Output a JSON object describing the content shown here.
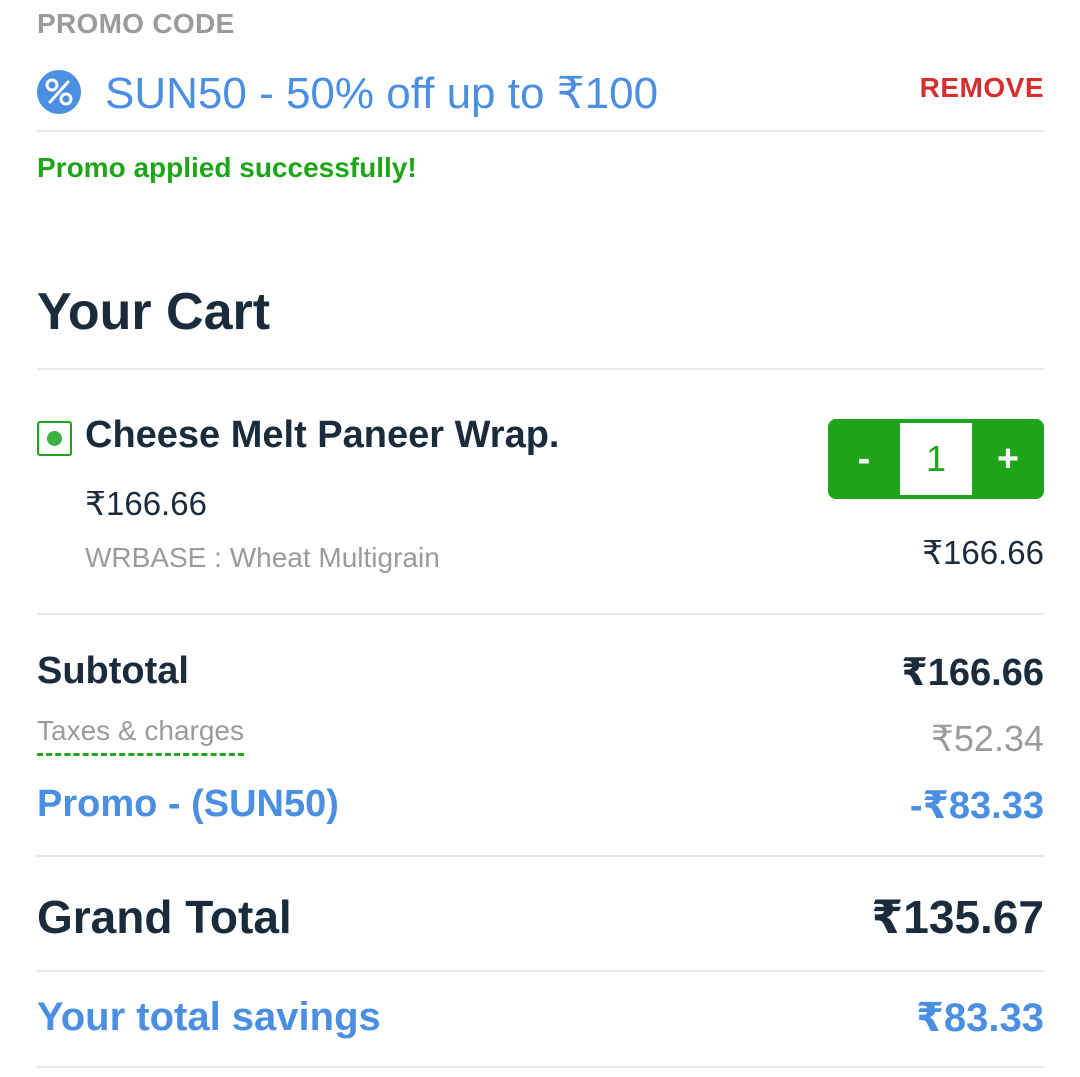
{
  "promo": {
    "section_label": "PROMO CODE",
    "applied_text": "SUN50 - 50% off up to ₹100",
    "remove_label": "REMOVE",
    "success_message": "Promo applied successfully!",
    "icon": "percent-badge-icon"
  },
  "cart": {
    "title": "Your Cart",
    "items": [
      {
        "veg_icon": "veg-indicator-icon",
        "name": "Cheese Melt Paneer Wrap.",
        "unit_price": "₹166.66",
        "customization": "WRBASE : Wheat Multigrain",
        "quantity": "1",
        "decrement_label": "-",
        "increment_label": "+",
        "line_total": "₹166.66"
      }
    ]
  },
  "bill": {
    "subtotal_label": "Subtotal",
    "subtotal_value": "₹166.66",
    "taxes_label": "Taxes & charges",
    "taxes_value": "₹52.34",
    "promo_label": "Promo - (SUN50)",
    "promo_value": "-₹83.33",
    "grand_total_label": "Grand Total",
    "grand_total_value": "₹135.67",
    "savings_label": "Your total savings",
    "savings_value": "₹83.33"
  },
  "colors": {
    "accent_blue": "#4a8fe2",
    "success_green": "#1fa51a",
    "remove_red": "#d62d2d",
    "text_dark": "#1a2b3c",
    "text_muted": "#9b9b9b"
  }
}
